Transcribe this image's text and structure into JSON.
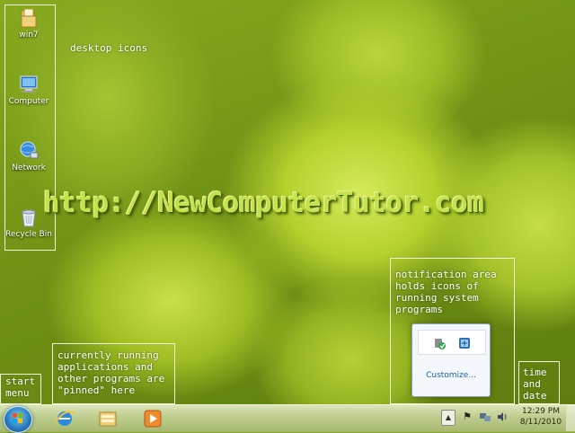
{
  "desktop": {
    "icons": [
      {
        "label": "win7",
        "icon": "folder-icon"
      },
      {
        "label": "Computer",
        "icon": "computer-icon"
      },
      {
        "label": "Network",
        "icon": "network-icon"
      },
      {
        "label": "Recycle Bin",
        "icon": "recycle-bin-icon"
      }
    ],
    "watermark": "http://NewComputerTutor.com"
  },
  "annotations": {
    "desktop_icons": "desktop icons",
    "notification_area": [
      "notification area",
      "holds icons of",
      "running system",
      "programs"
    ],
    "running_apps": [
      "currently running",
      "applications and",
      "other programs are",
      "\"pinned\" here"
    ],
    "start_menu": [
      "start",
      "menu"
    ],
    "time_date": [
      "time",
      "and",
      "date"
    ]
  },
  "tray_popup": {
    "icons": [
      "safely-remove-hardware-icon",
      "network-adapter-icon"
    ],
    "customize": "Customize..."
  },
  "taskbar": {
    "start_icon": "windows-orb-icon",
    "pinned": [
      "internet-explorer-icon",
      "windows-explorer-icon",
      "media-player-icon"
    ],
    "tray_icons": [
      "flag-icon",
      "network-icon",
      "volume-icon"
    ],
    "time": "12:29 PM",
    "date": "8/11/2010"
  },
  "colors": {
    "annotation": "#ffffff",
    "link": "#1f5fb3",
    "watermark": "#c5e24c"
  }
}
